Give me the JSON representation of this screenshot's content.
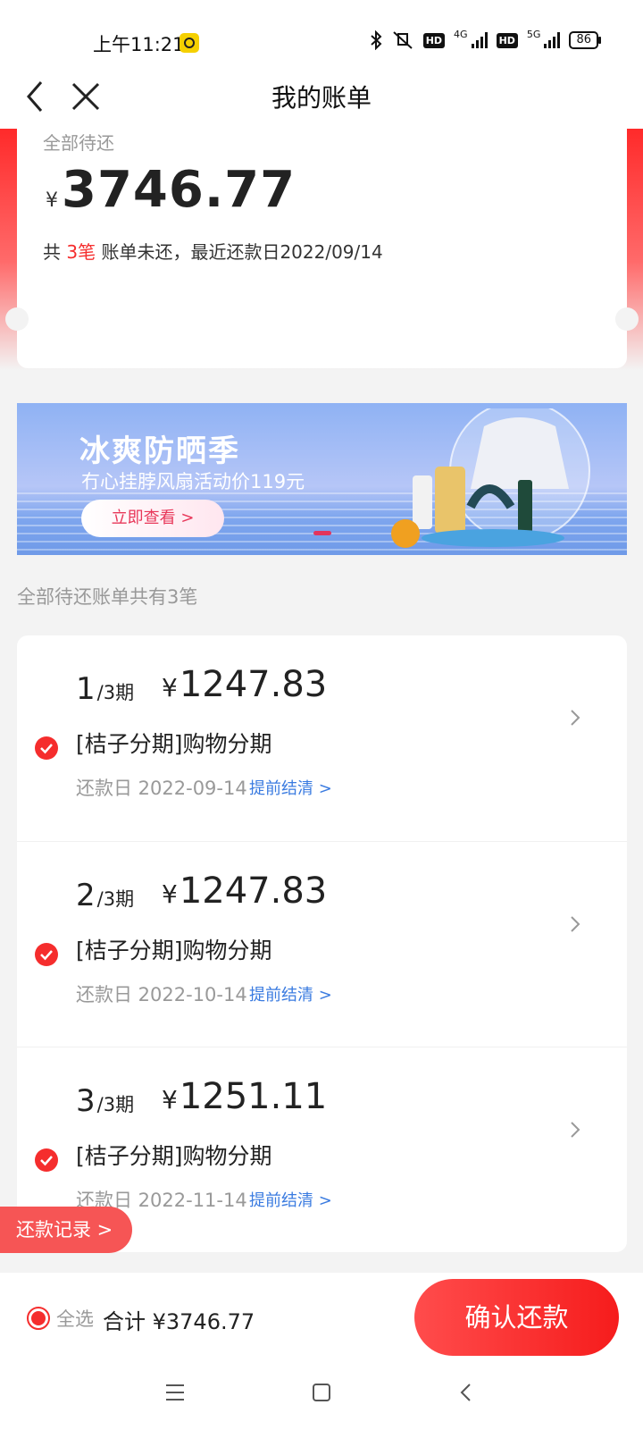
{
  "status_bar": {
    "time": "上午11:21",
    "net_4g": "4G",
    "net_5g": "5G",
    "hd": "HD",
    "battery": "86"
  },
  "nav": {
    "title": "我的账单"
  },
  "summary": {
    "label": "全部待还",
    "currency": "¥",
    "amount": "3746.77",
    "desc_prefix": "共 ",
    "desc_count": "3笔",
    "desc_suffix": " 账单未还，最近还款日2022/09/14"
  },
  "banner": {
    "title": "冰爽防晒季",
    "subtitle": "冇心挂脖风扇活动价119元",
    "button": "立即查看 >"
  },
  "bills_count_text": "全部待还账单共有3笔",
  "bills": [
    {
      "index": "1",
      "total": "/3期",
      "currency": "¥",
      "amount": "1247.83",
      "name": "[桔子分期]购物分期",
      "date": "还款日 2022-09-14",
      "early": "提前结清 >"
    },
    {
      "index": "2",
      "total": "/3期",
      "currency": "¥",
      "amount": "1247.83",
      "name": "[桔子分期]购物分期",
      "date": "还款日 2022-10-14",
      "early": "提前结清 >"
    },
    {
      "index": "3",
      "total": "/3期",
      "currency": "¥",
      "amount": "1251.11",
      "name": "[桔子分期]购物分期",
      "date": "还款日 2022-11-14",
      "early": "提前结清 >"
    }
  ],
  "repay_record": "还款记录 >",
  "bottom": {
    "select_all": "全选",
    "total": "合计 ¥3746.77",
    "confirm": "确认还款"
  },
  "colors": {
    "accent": "#f52d2d",
    "link": "#3a7be0"
  }
}
